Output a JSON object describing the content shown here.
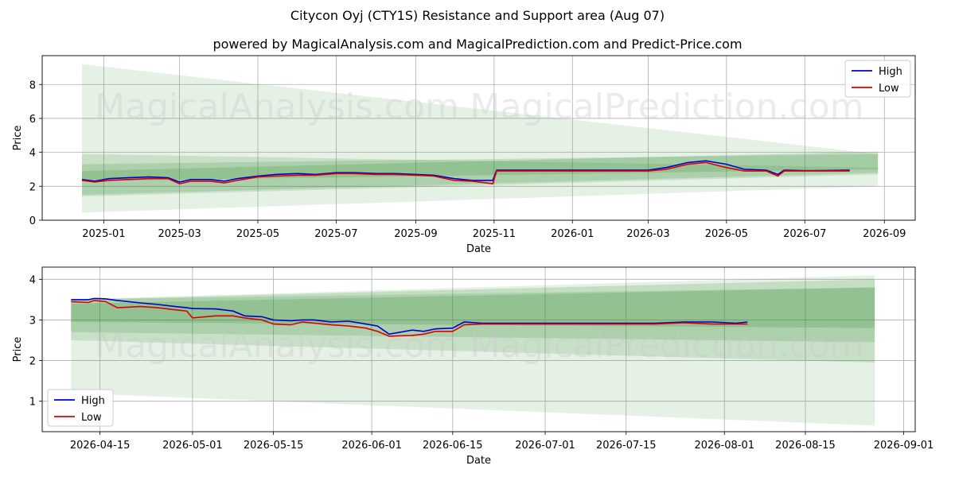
{
  "title": "Citycon Oyj (CTY1S) Resistance and Support area (Aug 07)",
  "subtitle": "powered by MagicalAnalysis.com and MagicalPrediction.com and Predict-Price.com",
  "watermarks": [
    "MagicalAnalysis.com",
    "MagicalPrediction.com"
  ],
  "colors": {
    "high": "#0000cc",
    "low": "#dd0000",
    "band": "#2e8b2e",
    "grid": "#b0b0b0"
  },
  "chart_data": [
    {
      "type": "line",
      "xlabel": "Date",
      "ylabel": "Price",
      "x_ticks": [
        "2025-01",
        "2025-03",
        "2025-05",
        "2025-07",
        "2025-09",
        "2025-11",
        "2026-01",
        "2026-03",
        "2026-05",
        "2026-07",
        "2026-09"
      ],
      "y_ticks": [
        "0",
        "2",
        "4",
        "6",
        "8"
      ],
      "xlim": [
        "2024-11-14",
        "2026-09-25"
      ],
      "ylim": [
        0,
        9.7
      ],
      "legend": "top-right",
      "grid": true,
      "bands": [
        {
          "start": "2024-12-15",
          "end": "2026-08-27",
          "lower": [
            0.45,
            2.0
          ],
          "upper": [
            9.2,
            3.9
          ],
          "opacity": 0.12
        },
        {
          "start": "2024-12-15",
          "end": "2026-08-27",
          "lower": [
            1.4,
            2.7
          ],
          "upper": [
            3.9,
            3.1
          ],
          "opacity": 0.16
        },
        {
          "start": "2024-12-15",
          "end": "2026-08-27",
          "lower": [
            1.5,
            2.8
          ],
          "upper": [
            3.3,
            3.9
          ],
          "opacity": 0.18
        },
        {
          "start": "2024-12-15",
          "end": "2026-08-27",
          "lower": [
            2.3,
            3.0
          ],
          "upper": [
            2.9,
            4.05
          ],
          "opacity": 0.2
        }
      ],
      "series": [
        {
          "name": "High",
          "x": [
            "2024-12-15",
            "2024-12-25",
            "2025-01-05",
            "2025-01-20",
            "2025-02-05",
            "2025-02-20",
            "2025-03-01",
            "2025-03-10",
            "2025-03-25",
            "2025-04-05",
            "2025-04-15",
            "2025-05-01",
            "2025-05-15",
            "2025-06-01",
            "2025-06-15",
            "2025-07-01",
            "2025-07-15",
            "2025-08-01",
            "2025-08-15",
            "2025-09-01",
            "2025-09-15",
            "2025-10-01",
            "2025-10-15",
            "2025-10-31",
            "2025-11-03",
            "2025-12-01",
            "2026-01-01",
            "2026-02-01",
            "2026-03-01",
            "2026-03-15",
            "2026-04-01",
            "2026-04-15",
            "2026-05-01",
            "2026-05-15",
            "2026-06-01",
            "2026-06-10",
            "2026-06-15",
            "2026-07-01",
            "2026-07-15",
            "2026-08-05"
          ],
          "values": [
            2.4,
            2.3,
            2.45,
            2.5,
            2.55,
            2.5,
            2.25,
            2.4,
            2.4,
            2.3,
            2.45,
            2.6,
            2.7,
            2.75,
            2.7,
            2.8,
            2.8,
            2.75,
            2.75,
            2.7,
            2.65,
            2.45,
            2.35,
            2.35,
            2.95,
            2.95,
            2.95,
            2.95,
            2.95,
            3.1,
            3.4,
            3.5,
            3.3,
            3.0,
            2.95,
            2.7,
            2.95,
            2.92,
            2.93,
            2.95
          ]
        },
        {
          "name": "Low",
          "x": [
            "2024-12-15",
            "2024-12-25",
            "2025-01-05",
            "2025-01-20",
            "2025-02-05",
            "2025-02-20",
            "2025-03-01",
            "2025-03-10",
            "2025-03-25",
            "2025-04-05",
            "2025-04-15",
            "2025-05-01",
            "2025-05-15",
            "2025-06-01",
            "2025-06-15",
            "2025-07-01",
            "2025-07-15",
            "2025-08-01",
            "2025-08-15",
            "2025-09-01",
            "2025-09-15",
            "2025-10-01",
            "2025-10-15",
            "2025-10-31",
            "2025-11-03",
            "2025-12-01",
            "2026-01-01",
            "2026-02-01",
            "2026-03-01",
            "2026-03-15",
            "2026-04-01",
            "2026-04-15",
            "2026-05-01",
            "2026-05-15",
            "2026-06-01",
            "2026-06-10",
            "2026-06-15",
            "2026-07-01",
            "2026-07-15",
            "2026-08-05"
          ],
          "values": [
            2.35,
            2.25,
            2.35,
            2.4,
            2.45,
            2.45,
            2.15,
            2.3,
            2.3,
            2.2,
            2.35,
            2.55,
            2.6,
            2.65,
            2.65,
            2.75,
            2.75,
            2.7,
            2.7,
            2.65,
            2.6,
            2.35,
            2.3,
            2.15,
            2.9,
            2.9,
            2.9,
            2.9,
            2.9,
            3.0,
            3.3,
            3.4,
            3.1,
            2.9,
            2.9,
            2.6,
            2.9,
            2.9,
            2.9,
            2.9
          ]
        }
      ]
    },
    {
      "type": "line",
      "xlabel": "Date",
      "ylabel": "Price",
      "x_ticks": [
        "2026-04-15",
        "2026-05-01",
        "2026-05-15",
        "2026-06-01",
        "2026-06-15",
        "2026-07-01",
        "2026-07-15",
        "2026-08-01",
        "2026-08-15",
        "2026-09-01"
      ],
      "y_ticks": [
        "1",
        "2",
        "3",
        "4"
      ],
      "xlim": [
        "2026-04-05",
        "2026-09-03"
      ],
      "ylim": [
        0.25,
        4.3
      ],
      "legend": "bottom-left",
      "grid": true,
      "bands": [
        {
          "start": "2026-04-10",
          "end": "2026-08-27",
          "lower": [
            1.2,
            0.4
          ],
          "upper": [
            3.5,
            4.1
          ],
          "opacity": 0.12
        },
        {
          "start": "2026-04-10",
          "end": "2026-08-27",
          "lower": [
            2.5,
            1.95
          ],
          "upper": [
            3.5,
            3.8
          ],
          "opacity": 0.16
        },
        {
          "start": "2026-04-10",
          "end": "2026-08-27",
          "lower": [
            2.7,
            2.45
          ],
          "upper": [
            3.5,
            4.0
          ],
          "opacity": 0.18
        },
        {
          "start": "2026-04-10",
          "end": "2026-08-27",
          "lower": [
            2.95,
            2.8
          ],
          "upper": [
            3.4,
            3.8
          ],
          "opacity": 0.2
        }
      ],
      "series": [
        {
          "name": "High",
          "x": [
            "2026-04-10",
            "2026-04-13",
            "2026-04-14",
            "2026-04-16",
            "2026-04-18",
            "2026-04-22",
            "2026-04-25",
            "2026-04-28",
            "2026-04-30",
            "2026-05-01",
            "2026-05-05",
            "2026-05-08",
            "2026-05-10",
            "2026-05-13",
            "2026-05-15",
            "2026-05-18",
            "2026-05-20",
            "2026-05-22",
            "2026-05-25",
            "2026-05-28",
            "2026-05-31",
            "2026-06-02",
            "2026-06-04",
            "2026-06-08",
            "2026-06-10",
            "2026-06-12",
            "2026-06-15",
            "2026-06-17",
            "2026-06-20",
            "2026-06-25",
            "2026-07-01",
            "2026-07-10",
            "2026-07-20",
            "2026-07-25",
            "2026-07-30",
            "2026-08-03",
            "2026-08-05"
          ],
          "values": [
            3.5,
            3.5,
            3.53,
            3.52,
            3.48,
            3.42,
            3.38,
            3.33,
            3.3,
            3.28,
            3.27,
            3.22,
            3.1,
            3.08,
            3.0,
            2.98,
            3.0,
            3.0,
            2.95,
            2.97,
            2.9,
            2.85,
            2.65,
            2.75,
            2.72,
            2.78,
            2.8,
            2.95,
            2.92,
            2.92,
            2.92,
            2.92,
            2.92,
            2.95,
            2.95,
            2.92,
            2.95
          ]
        },
        {
          "name": "Low",
          "x": [
            "2026-04-10",
            "2026-04-13",
            "2026-04-14",
            "2026-04-16",
            "2026-04-18",
            "2026-04-22",
            "2026-04-25",
            "2026-04-28",
            "2026-04-30",
            "2026-05-01",
            "2026-05-05",
            "2026-05-08",
            "2026-05-10",
            "2026-05-13",
            "2026-05-15",
            "2026-05-18",
            "2026-05-20",
            "2026-05-22",
            "2026-05-25",
            "2026-05-28",
            "2026-05-31",
            "2026-06-02",
            "2026-06-04",
            "2026-06-08",
            "2026-06-10",
            "2026-06-12",
            "2026-06-15",
            "2026-06-17",
            "2026-06-20",
            "2026-06-25",
            "2026-07-01",
            "2026-07-10",
            "2026-07-20",
            "2026-07-25",
            "2026-07-30",
            "2026-08-03",
            "2026-08-05"
          ],
          "values": [
            3.45,
            3.43,
            3.48,
            3.45,
            3.3,
            3.33,
            3.3,
            3.25,
            3.22,
            3.05,
            3.1,
            3.1,
            3.05,
            3.0,
            2.9,
            2.88,
            2.95,
            2.92,
            2.88,
            2.85,
            2.8,
            2.72,
            2.6,
            2.62,
            2.65,
            2.72,
            2.72,
            2.88,
            2.9,
            2.9,
            2.9,
            2.9,
            2.9,
            2.93,
            2.9,
            2.9,
            2.9
          ]
        }
      ]
    }
  ]
}
